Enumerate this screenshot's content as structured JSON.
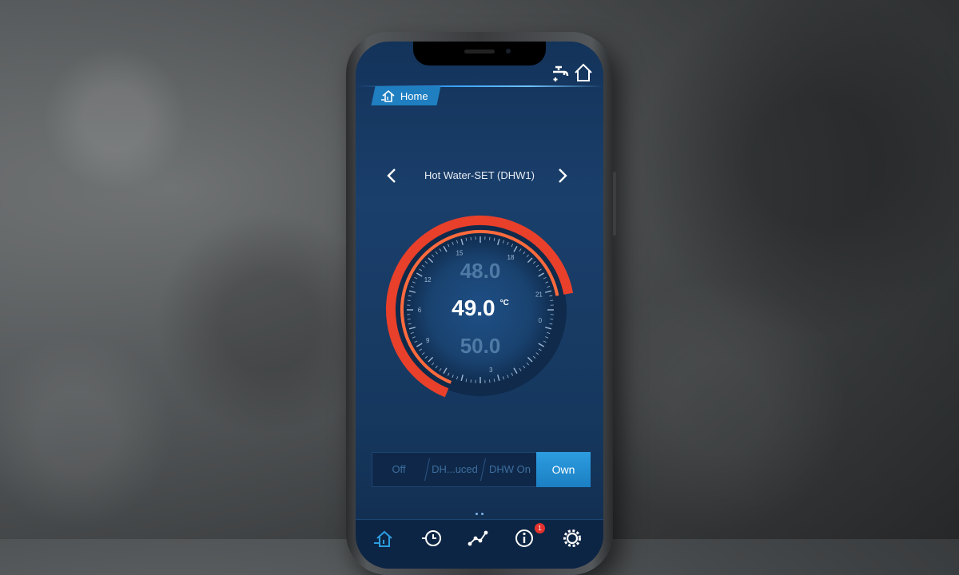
{
  "header": {
    "home_label": "Home",
    "top_icons": [
      "water-tap-icon",
      "house-icon"
    ]
  },
  "navigator": {
    "title": "Hot Water-SET (DHW1)",
    "prev_icon": "chevron-left-icon",
    "next_icon": "chevron-right-icon"
  },
  "dial": {
    "temp_above": "48.0",
    "temp_current": "49.0",
    "temp_below": "50.0",
    "unit": "°C",
    "tick_labels": [
      "15",
      "18",
      "12",
      "21",
      "9",
      "0",
      "6",
      "3"
    ],
    "level_fraction": 0.66,
    "colors": {
      "arc_outer": "#e8402a",
      "arc_inner": "#ff6a3d",
      "face": "#1a3f6b"
    }
  },
  "modes": {
    "options": [
      "Off",
      "DH...uced",
      "DHW On",
      "Own"
    ],
    "selected": "Own"
  },
  "bottom_nav": {
    "items": [
      "home-icon",
      "clock-history-icon",
      "graph-icon",
      "info-icon",
      "gear-icon"
    ],
    "info_badge": "1"
  }
}
